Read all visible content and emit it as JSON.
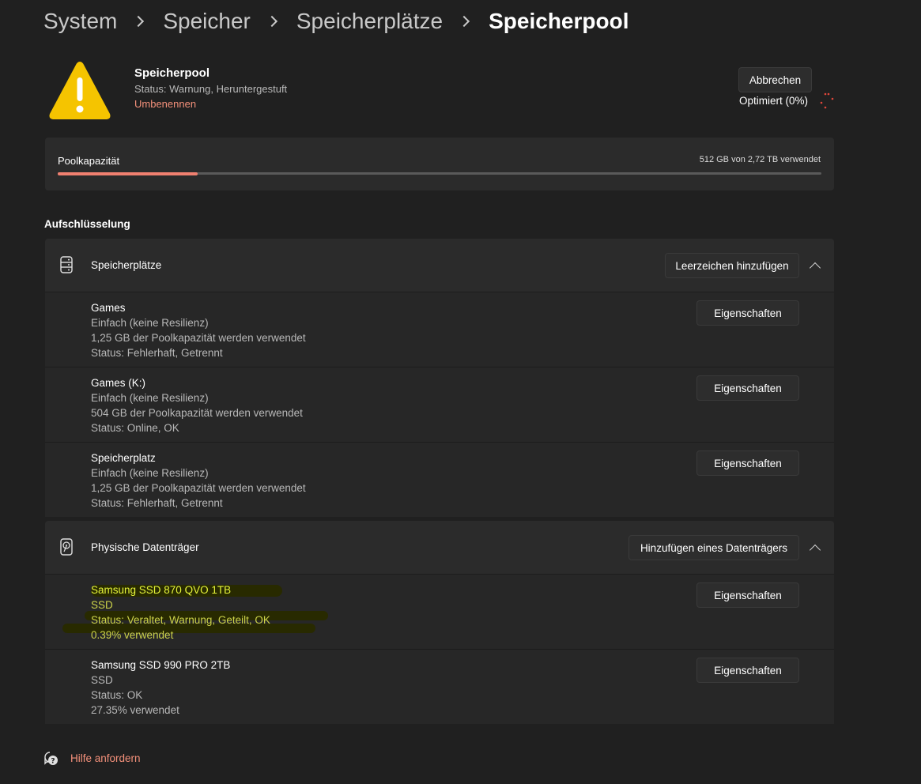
{
  "breadcrumb": [
    "System",
    "Speicher",
    "Speicherplätze",
    "Speicherpool"
  ],
  "pool": {
    "title": "Speicherpool",
    "status": "Status: Warnung, Heruntergestuft",
    "rename": "Umbenennen",
    "cancel_label": "Abbrechen",
    "optimize_status": "Optimiert (0%)"
  },
  "capacity": {
    "label": "Poolkapazität",
    "used_text": "512 GB von 2,72 TB verwendet",
    "used_fraction": 0.183
  },
  "breakdown_title": "Aufschlüsselung",
  "spaces": {
    "title": "Speicherplätze",
    "add_label": "Leerzeichen hinzufügen",
    "items": [
      {
        "name": "Games",
        "type": "Einfach (keine Resilienz)",
        "usage": "1,25 GB der Poolkapazität werden verwendet",
        "status": "Status: Fehlerhaft, Getrennt",
        "button": "Eigenschaften"
      },
      {
        "name": "Games (K:)",
        "type": "Einfach (keine Resilienz)",
        "usage": "504 GB der Poolkapazität werden verwendet",
        "status": "Status: Online, OK",
        "button": "Eigenschaften"
      },
      {
        "name": "Speicherplatz",
        "type": "Einfach (keine Resilienz)",
        "usage": "1,25 GB der Poolkapazität werden verwendet",
        "status": "Status: Fehlerhaft, Getrennt",
        "button": "Eigenschaften"
      }
    ]
  },
  "disks": {
    "title": "Physische Datenträger",
    "add_label": "Hinzufügen eines Datenträgers",
    "items": [
      {
        "name": "Samsung SSD 870 QVO 1TB",
        "type": "SSD",
        "status": "Status: Veraltet, Warnung, Geteilt, OK",
        "usage": "0.39% verwendet",
        "button": "Eigenschaften"
      },
      {
        "name": "Samsung SSD 990 PRO 2TB",
        "type": "SSD",
        "status": "Status: OK",
        "usage": "27.35% verwendet",
        "button": "Eigenschaften"
      }
    ]
  },
  "help": {
    "label": "Hilfe anfordern"
  },
  "colors": {
    "background": "#202020",
    "card": "#2b2b2b",
    "accent": "#f08070",
    "link": "#f3907a",
    "warning": "#f5c400",
    "highlight": "#e6f53a"
  },
  "icons": {
    "warning": "warning-triangle-icon",
    "spaces": "server-stack-icon",
    "disks": "hard-drive-icon",
    "help": "help-chat-icon"
  }
}
